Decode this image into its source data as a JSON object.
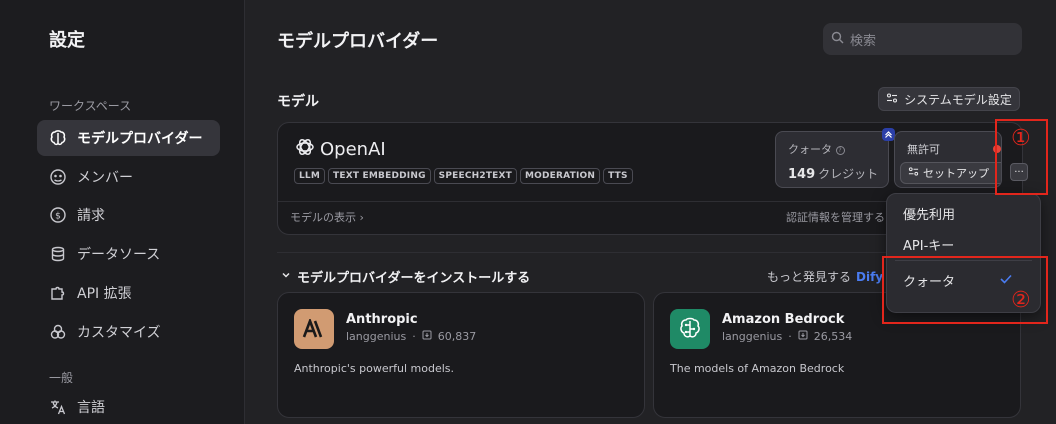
{
  "sidebar": {
    "title": "設定",
    "workspace_label": "ワークスペース",
    "general_label": "一般",
    "items": [
      {
        "label": "モデルプロバイダー",
        "icon": "brain-icon"
      },
      {
        "label": "メンバー",
        "icon": "members-icon"
      },
      {
        "label": "請求",
        "icon": "billing-icon"
      },
      {
        "label": "データソース",
        "icon": "database-icon"
      },
      {
        "label": "API 拡張",
        "icon": "puzzle-icon"
      },
      {
        "label": "カスタマイズ",
        "icon": "customize-icon"
      },
      {
        "label": "言語",
        "icon": "translate-icon"
      }
    ]
  },
  "header": {
    "title": "モデルプロバイダー",
    "search_placeholder": "検索"
  },
  "models_section": {
    "label": "モデル",
    "system_settings_button": "システムモデル設定"
  },
  "provider_card": {
    "name": "OpenAI",
    "tags": [
      "LLM",
      "TEXT EMBEDDING",
      "SPEECH2TEXT",
      "MODERATION",
      "TTS"
    ],
    "quota_label": "クォータ",
    "quota_value": "149",
    "quota_unit": "クレジット",
    "status_label": "無許可",
    "setup_button": "セットアップ",
    "more_button": "···",
    "show_models": "モデルの表示",
    "manage_credentials": "認証情報を管理する"
  },
  "install_section": {
    "title": "モデルプロバイダーをインストールする",
    "more_discover": "もっと発見する",
    "dify": "Dify"
  },
  "plugins": [
    {
      "name": "Anthropic",
      "author": "langgenius",
      "downloads": "60,837",
      "description": "Anthropic's powerful models."
    },
    {
      "name": "Amazon Bedrock",
      "author": "langgenius",
      "downloads": "26,534",
      "description": "The models of Amazon Bedrock"
    }
  ],
  "dropdown": {
    "items": [
      "優先利用",
      "API-キー",
      "クォータ"
    ],
    "selected": "クォータ"
  },
  "annotations": {
    "step1": "①",
    "step2": "②"
  },
  "colors": {
    "accent": "#4a7cf0",
    "annotation_red": "#e2261c",
    "status_red": "#e5453a",
    "anthropic_bg": "#d19b72",
    "bedrock_bg": "#1f8a66"
  }
}
